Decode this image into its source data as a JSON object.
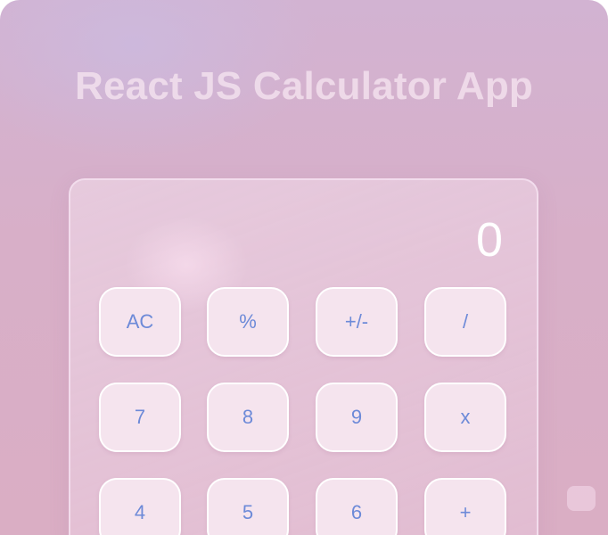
{
  "app": {
    "title": "React JS Calculator App"
  },
  "display": {
    "value": "0"
  },
  "keypad": {
    "rows": [
      [
        "AC",
        "%",
        "+/-",
        "/"
      ],
      [
        "7",
        "8",
        "9",
        "x"
      ],
      [
        "4",
        "5",
        "6",
        "+"
      ]
    ]
  },
  "colors": {
    "background": "#d8afc8",
    "key_background": "#f5e4ee",
    "key_text": "#6d8ad8",
    "display_text": "#ffffff"
  }
}
